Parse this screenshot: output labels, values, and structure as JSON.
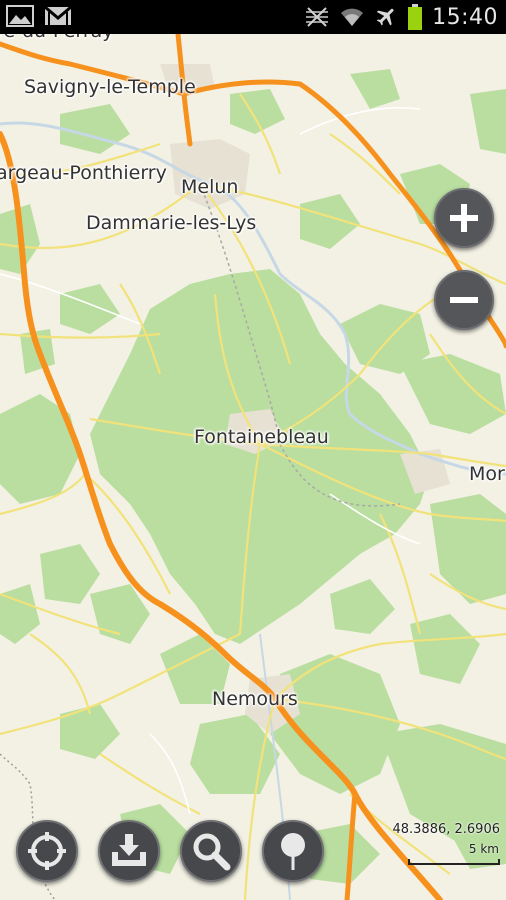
{
  "status_bar": {
    "time": "15:40",
    "left_icons": [
      "gallery-icon",
      "gmail-icon"
    ],
    "right_icons": [
      "no-signal-icon",
      "wifi-icon",
      "airplane-mode-icon",
      "battery-icon"
    ],
    "battery_color": "#9bd20f"
  },
  "map": {
    "places": [
      {
        "name": "re-du-Perray",
        "id": "perray"
      },
      {
        "name": "Savigny-le-Temple",
        "id": "savigny"
      },
      {
        "name": "argeau-Ponthierry",
        "id": "ponthierry"
      },
      {
        "name": "Melun",
        "id": "melun"
      },
      {
        "name": "Dammarie-les-Lys",
        "id": "dammarie"
      },
      {
        "name": "Fontainebleau",
        "id": "fontainebleau"
      },
      {
        "name": "Mor",
        "id": "moret"
      },
      {
        "name": "Nemours",
        "id": "nemours"
      }
    ],
    "colors": {
      "background": "#f3f1e4",
      "forest": "#b9dea0",
      "motorway": "#f7911e",
      "road": "#f2e27a",
      "water": "#c6d8e6"
    }
  },
  "controls": {
    "zoom_in": "+",
    "zoom_out": "−",
    "tools": [
      "my-location",
      "download",
      "search",
      "pin"
    ]
  },
  "coordinates": "48.3886, 2.6906",
  "scale": "5 km"
}
